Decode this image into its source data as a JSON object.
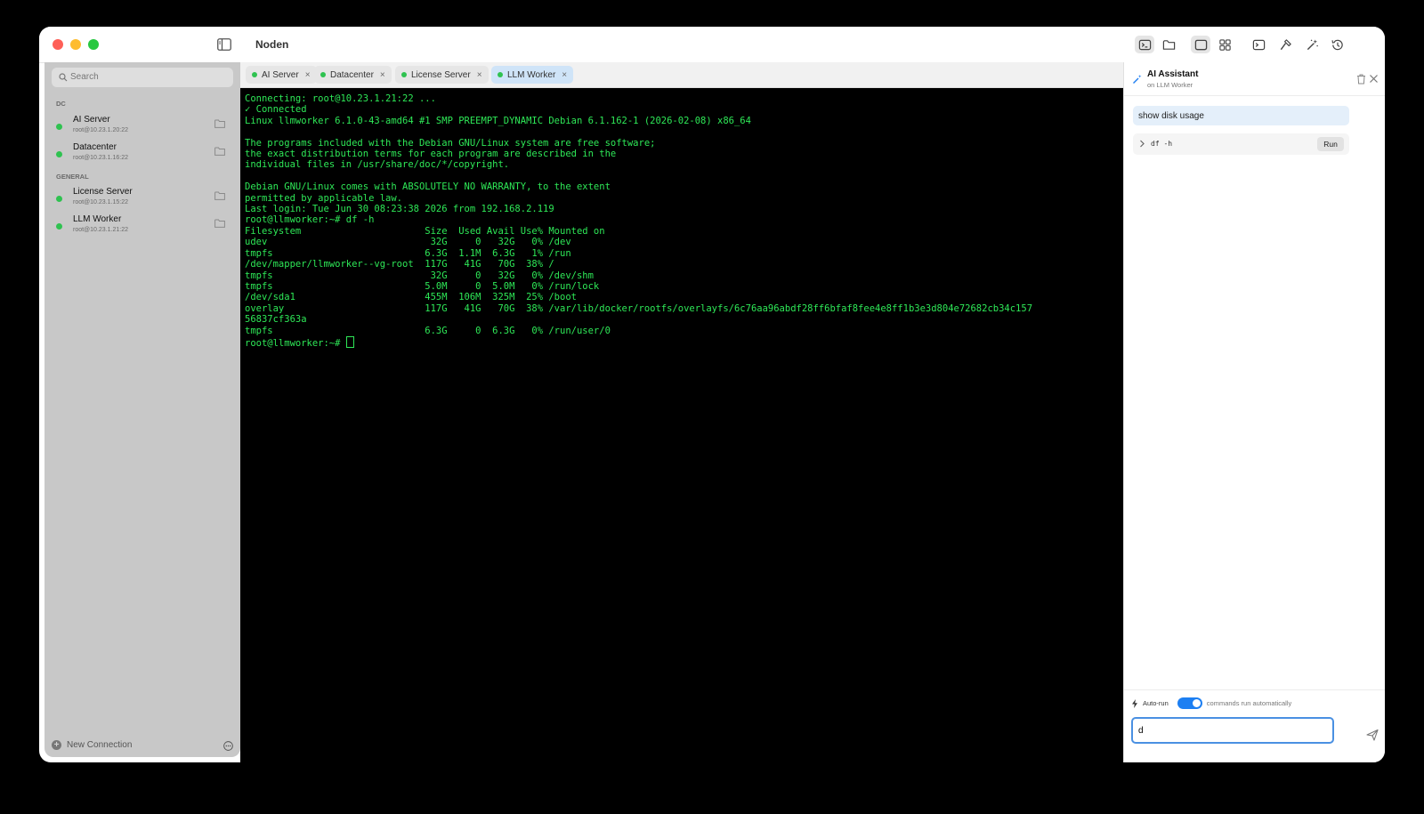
{
  "app": {
    "title": "Noden"
  },
  "sidebar": {
    "search_placeholder": "Search",
    "groups": [
      {
        "label": "DC",
        "hosts": [
          {
            "name": "AI Server",
            "address": "root@10.23.1.20:22"
          },
          {
            "name": "Datacenter",
            "address": "root@10.23.1.16:22"
          }
        ]
      },
      {
        "label": "GENERAL",
        "hosts": [
          {
            "name": "License Server",
            "address": "root@10.23.1.15:22"
          },
          {
            "name": "LLM Worker",
            "address": "root@10.23.1.21:22"
          }
        ]
      }
    ],
    "new_connection": "New Connection"
  },
  "tabs": [
    {
      "label": "AI Server",
      "close": "×"
    },
    {
      "label": "Datacenter",
      "close": "×"
    },
    {
      "label": "License Server",
      "close": "×"
    },
    {
      "label": "LLM Worker",
      "close": "×"
    }
  ],
  "terminal": {
    "lines": [
      "Connecting: root@10.23.1.21:22 ...",
      "✓ Connected",
      "Linux llmworker 6.1.0-43-amd64 #1 SMP PREEMPT_DYNAMIC Debian 6.1.162-1 (2026-02-08) x86_64",
      "",
      "The programs included with the Debian GNU/Linux system are free software;",
      "the exact distribution terms for each program are described in the",
      "individual files in /usr/share/doc/*/copyright.",
      "",
      "Debian GNU/Linux comes with ABSOLUTELY NO WARRANTY, to the extent",
      "permitted by applicable law.",
      "Last login: Tue Jun 30 08:23:38 2026 from 192.168.2.119",
      "root@llmworker:~# df -h",
      "Filesystem                      Size  Used Avail Use% Mounted on",
      "udev                             32G     0   32G   0% /dev",
      "tmpfs                           6.3G  1.1M  6.3G   1% /run",
      "/dev/mapper/llmworker--vg-root  117G   41G   70G  38% /",
      "tmpfs                            32G     0   32G   0% /dev/shm",
      "tmpfs                           5.0M     0  5.0M   0% /run/lock",
      "/dev/sda1                       455M  106M  325M  25% /boot",
      "overlay                         117G   41G   70G  38% /var/lib/docker/rootfs/overlayfs/6c76aa96abdf28ff6bfaf8fee4e8ff1b3e3d804e72682cb34c157",
      "56837cf363a",
      "tmpfs                           6.3G     0  6.3G   0% /run/user/0"
    ],
    "prompt": "root@llmworker:~# "
  },
  "ai": {
    "title": "AI Assistant",
    "subtitle": "on LLM Worker",
    "user_message": "show disk usage",
    "command": "df -h",
    "run_label": "Run",
    "autorun_label": "Auto-run",
    "autorun_desc": "commands run automatically",
    "autorun_on": true,
    "input_value": "d"
  },
  "colors": {
    "terminal_text": "#2ee857",
    "status_online": "#2fc250",
    "accent": "#1d7ff2",
    "active_tab": "#cfe4f8"
  },
  "icons": [
    "sidebar-toggle-icon",
    "terminal-icon",
    "folder-icon",
    "single-pane-icon",
    "grid-icon",
    "console-icon",
    "hammer-icon",
    "magic-wand-icon",
    "history-icon",
    "search-icon",
    "folder-icon",
    "plus-icon",
    "ellipsis-icon",
    "trash-icon",
    "close-icon",
    "chevron-right-icon",
    "bolt-icon",
    "send-icon"
  ]
}
